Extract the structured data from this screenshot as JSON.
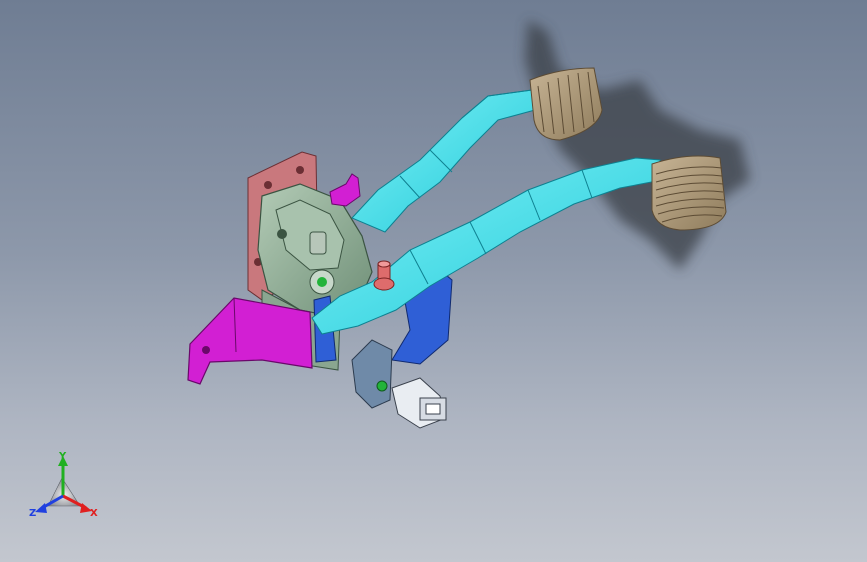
{
  "viewport": {
    "background_top": "#6f7d93",
    "background_bottom": "#c3c7cf"
  },
  "model": {
    "parts": [
      {
        "name": "clutch-pedal-arm",
        "color": "#3fe0e8"
      },
      {
        "name": "brake-pedal-arm",
        "color": "#19e6ee"
      },
      {
        "name": "pedal-pad",
        "color": "#b09c7a"
      },
      {
        "name": "mounting-bracket",
        "color": "#8fae95"
      },
      {
        "name": "firewall-plate",
        "color": "#c9787d"
      },
      {
        "name": "support-bracket",
        "color": "#d21fd3"
      },
      {
        "name": "return-spring-housing",
        "color": "#2f5fd6"
      },
      {
        "name": "pivot-pin",
        "color": "#de6c6c"
      },
      {
        "name": "stop-switch",
        "color": "#e9edf2"
      }
    ]
  },
  "triad": {
    "x_label": "X",
    "y_label": "Y",
    "z_label": "Z",
    "x_color": "#e02020",
    "y_color": "#20b020",
    "z_color": "#2040e0"
  }
}
